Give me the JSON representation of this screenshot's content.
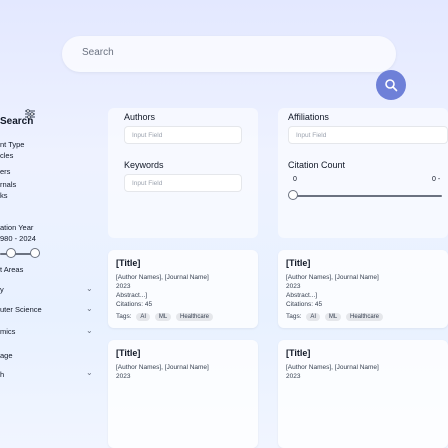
{
  "search": {
    "label": "Search"
  },
  "sidebar": {
    "title": "Search",
    "sections": [
      {
        "label": "nt Type"
      },
      {
        "label": "cles"
      },
      {
        "label": "ers"
      },
      {
        "label": "rnals"
      },
      {
        "label": "ks"
      }
    ],
    "pub_year_label": "ation Year",
    "pub_year_range": "980 - 2024",
    "areas_label": "t Areas",
    "areas": [
      {
        "label": "y"
      },
      {
        "label": "uter Science"
      },
      {
        "label": "mics"
      },
      {
        "label": "age"
      },
      {
        "label": "h"
      }
    ]
  },
  "form": {
    "authors_label": "Authors",
    "authors_placeholder": "Input Field",
    "affiliations_label": "Affiliations",
    "affiliations_placeholder": "Input Field",
    "keywords_label": "Keywords",
    "keywords_placeholder": "Input Field",
    "citation_label": "Citation Count",
    "citation_min": "0",
    "citation_max": "0 -"
  },
  "results": [
    {
      "title": "[Title]",
      "authors": "[Author Names], [Journal Name]",
      "year": "2023",
      "abstract": "Abstract...]",
      "citations": "Citations: 45",
      "tags_label": "Tags:",
      "tags": [
        "AI",
        "ML",
        "Healthcare"
      ]
    },
    {
      "title": "[Title]",
      "authors": "[Author Names], [Journal Name]",
      "year": "2023",
      "abstract": "Abstract...]",
      "citations": "Citations: 45",
      "tags_label": "Tags:",
      "tags": [
        "AI",
        "ML",
        "Healthcare"
      ]
    },
    {
      "title": "[Title]",
      "authors": "[Author Names], [Journal Name]",
      "year": "2023",
      "abstract": "",
      "citations": "",
      "tags_label": "",
      "tags": []
    },
    {
      "title": "[Title]",
      "authors": "[Author Names], [Journal Name]",
      "year": "2023",
      "abstract": "",
      "citations": "",
      "tags_label": "",
      "tags": []
    }
  ],
  "colors": {
    "accent": "#6e80d8"
  },
  "icons": {
    "search_button": "search-icon",
    "filter": "filter-icon",
    "chevron": "chevron-down-icon"
  }
}
